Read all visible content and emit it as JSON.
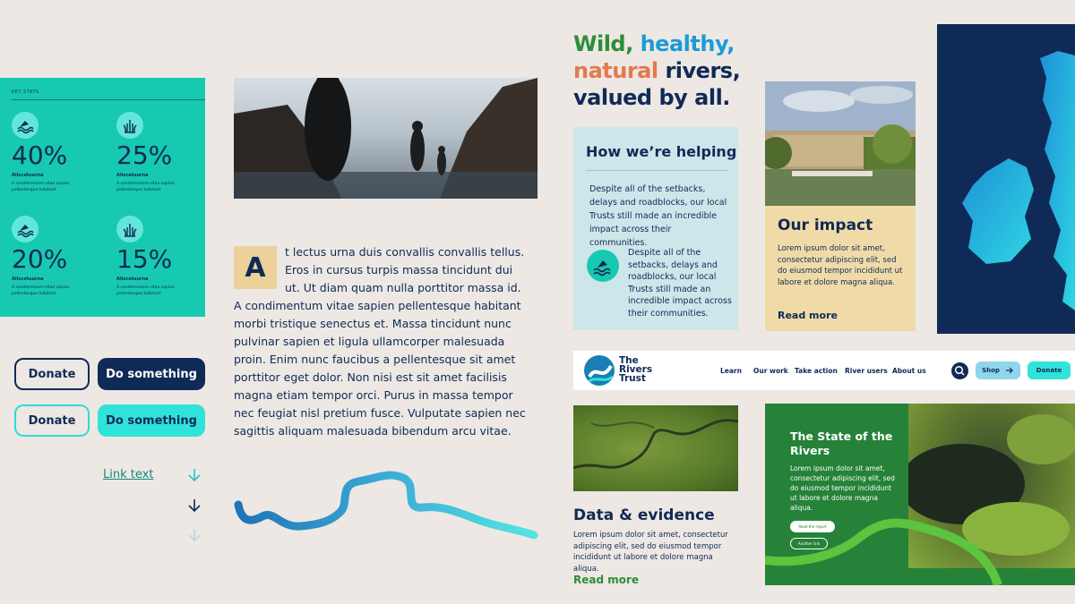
{
  "stats": {
    "header": "KEY STATS",
    "items": [
      {
        "value": "40%",
        "label": "Aliscetuurna",
        "desc": "A condimentum vitae sapien pellentesque habitant"
      },
      {
        "value": "25%",
        "label": "Aliscetuurna",
        "desc": "A condimentum vitae sapien pellentesque habitant"
      },
      {
        "value": "20%",
        "label": "Aliscetuurna",
        "desc": "A condimentum vitae sapien pellentesque habitant"
      },
      {
        "value": "15%",
        "label": "Aliscetuurna",
        "desc": "A condimentum vitae sapien pellentesque habitant"
      }
    ]
  },
  "buttons": {
    "donate_outline": "Donate",
    "do_something_dark": "Do something",
    "donate_outline_teal": "Donate",
    "do_something_teal": "Do something",
    "link_text": "Link text"
  },
  "article": {
    "dropcap": "A",
    "first_lines": "t lectus urna duis convallis convallis tellus. Eros in cursus turpis massa tincidunt dui ut. Ut diam quam nulla porttitor massa id.",
    "body": "A condimentum vitae sapien pellentesque habitant morbi tristique senectus et. Massa tincidunt nunc pulvinar sapien et ligula ullamcorper malesuada proin. Enim nunc faucibus a pellentesque sit amet porttitor eget dolor. Non nisi est sit amet facilisis magna etiam tempor orci. Purus in massa tempor nec feugiat nisl pretium fusce. Vulputate sapien nec sagittis aliquam malesuada bibendum arcu vitae."
  },
  "headline": {
    "part1": "Wild,",
    "part2": "healthy,",
    "part3": "natural",
    "part4": "rivers,",
    "part5": "valued by all."
  },
  "helping": {
    "title": "How we’re helping",
    "p1": "Despite all of the setbacks, delays and roadblocks, our local Trusts still made an incredible impact across their communities.",
    "p2": "Despite all of the setbacks, delays and roadblocks, our local Trusts still made an incredible impact across their communities."
  },
  "impact": {
    "title": "Our impact",
    "text": "Lorem ipsum dolor sit amet, consectetur adipiscing elit, sed do eiusmod tempor incididunt ut labore et dolore magna aliqua.",
    "read_more": "Read more"
  },
  "nav": {
    "brand_line1": "The",
    "brand_line2": "Rivers",
    "brand_line3": "Trust",
    "items": [
      "Learn",
      "Our work",
      "Take action",
      "River users",
      "About us"
    ],
    "shop": "Shop",
    "donate": "Donate"
  },
  "data_evidence": {
    "title": "Data & evidence",
    "text": "Lorem ipsum dolor sit amet, consectetur adipiscing elit, sed do eiusmod tempor incididunt ut labore et dolore magna aliqua.",
    "read_more": "Read more"
  },
  "state": {
    "title": "The State of the Rivers",
    "text": "Lorem ipsum dolor sit amet, consectetur adipiscing elit, sed do eiusmod tempor incididunt ut labore et dolore magna aliqua.",
    "btn1": "Read the report",
    "btn2": "Another link"
  },
  "colors": {
    "navy": "#0f2a56",
    "teal": "#17c9b1",
    "bright_teal": "#30e3da",
    "green": "#2b8f3a",
    "blue": "#1a9bd6",
    "orange": "#e2794f",
    "sand": "#f0dba8",
    "pale_blue": "#cde6ea",
    "background": "#ede8e3"
  },
  "icons": [
    "wave-swimmer-icon",
    "reed-plant-icon",
    "search-icon",
    "arrow-right-icon",
    "arrow-down-icon",
    "river-logo-icon"
  ]
}
